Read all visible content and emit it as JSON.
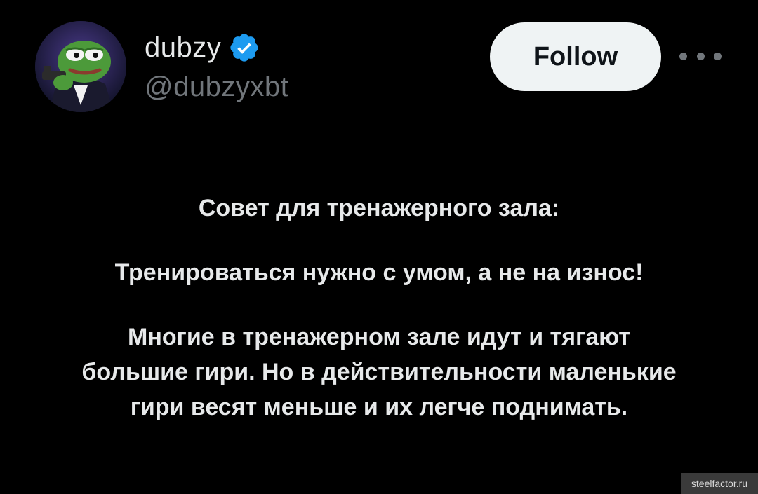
{
  "author": {
    "display_name": "dubzy",
    "handle": "@dubzyxbt",
    "verified": true,
    "avatar": "pepe-frog-avatar-icon"
  },
  "actions": {
    "follow_label": "Follow",
    "more_icon": "more-horizontal-icon"
  },
  "tweet": {
    "title": "Совет для тренажерного зала:",
    "line1": "Тренироваться нужно с умом, а не на износ!",
    "paragraph_line1": "Многие в тренажерном зале идут и тягают",
    "paragraph_line2": "большие гири. Но в действительности маленькие",
    "paragraph_line3": "гири весят меньше и их легче поднимать."
  },
  "watermark": {
    "text": "steelfactor.ru"
  },
  "colors": {
    "background": "#000000",
    "text_primary": "#e7e9ea",
    "text_secondary": "#71767b",
    "verified_badge": "#1d9bf0",
    "follow_button_bg": "#eff3f4"
  }
}
